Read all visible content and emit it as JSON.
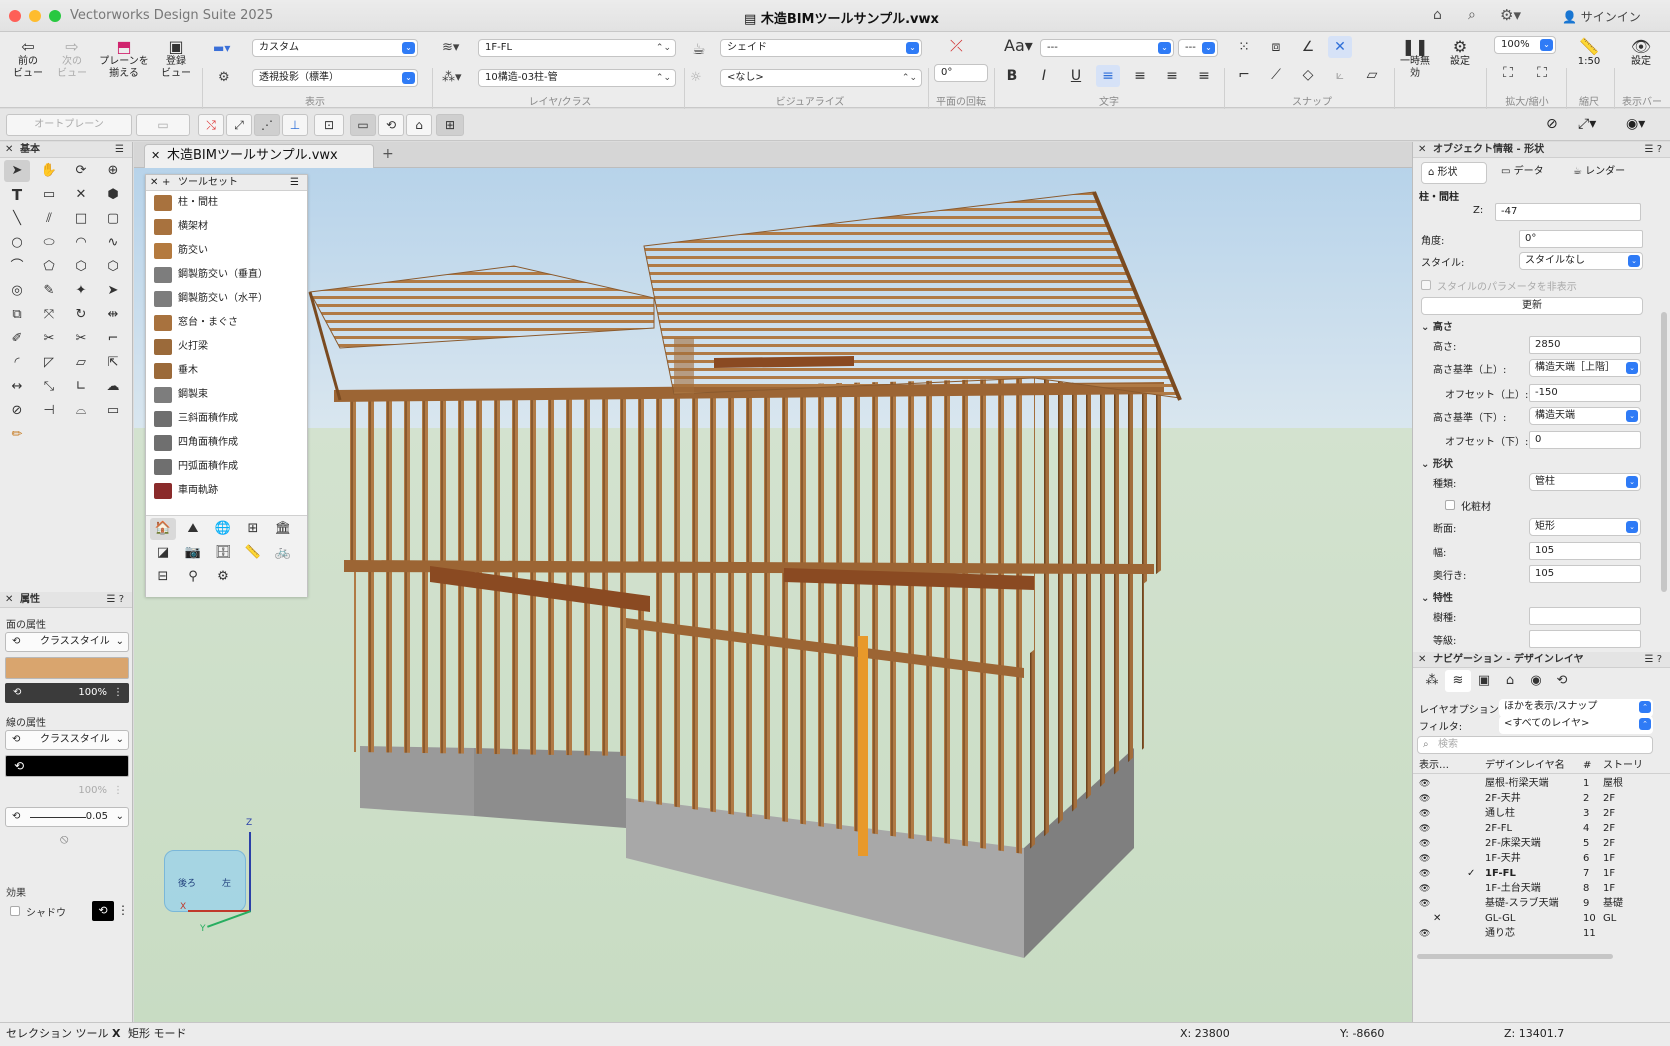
{
  "app_title": "Vectorworks Design Suite 2025",
  "doc_title": "木造BIMツールサンプル.vwx",
  "signin": "サインイン",
  "ribbon": {
    "prev_view": "前の\nビュー",
    "next_view": "次の\nビュー",
    "align_plane": "プレーンを\n揃える",
    "register_view": "登録\nビュー",
    "view_group": "表示",
    "layer_group": "レイヤ/クラス",
    "visualize_group": "ビジュアライズ",
    "plane_rot_group": "平面の回転",
    "text_group": "文字",
    "snap_group": "スナップ",
    "zoom_group": "拡大/縮小",
    "scale_group": "縮尺",
    "display_bar_group": "表示バー",
    "view_select": "カスタム",
    "projection": "透視投影（標準）",
    "layer": "1F-FL",
    "class": "10構造-03柱-管",
    "render_mode": "シェイド",
    "light": "<なし>",
    "rotation": "0°",
    "font": "---",
    "font_size": "---",
    "pause": "一時無効",
    "settings": "設定",
    "zoom": "100%",
    "scale": "1:50",
    "display_settings": "設定"
  },
  "toolbar2": {
    "auto_plane": "オートプレーン"
  },
  "left_panel": {
    "basic_title": "基本",
    "attr_title": "属性",
    "fill_attr": "面の属性",
    "fill_style": "クラススタイル",
    "fill_opacity": "100%",
    "line_attr": "線の属性",
    "line_style": "クラススタイル",
    "line_opacity": "100%",
    "line_weight": "0.05",
    "effects": "効果",
    "shadow": "シャドウ",
    "fill_color": "#d9a56e",
    "line_color": "#000000"
  },
  "tab": {
    "name": "木造BIMツールサンプル.vwx"
  },
  "toolset": {
    "title": "ツールセット",
    "items": [
      "柱・間柱",
      "横架材",
      "筋交い",
      "鋼製筋交い（垂直）",
      "鋼製筋交い（水平）",
      "窓台・まぐさ",
      "火打梁",
      "垂木",
      "鋼製束",
      "三斜面積作成",
      "四角面積作成",
      "円弧面積作成",
      "車両軌跡"
    ]
  },
  "viewcube": {
    "face1": "後ろ",
    "face2": "左",
    "axis_z": "Z",
    "axis_x": "X",
    "axis_y": "Y"
  },
  "obj_info": {
    "title": "オブジェクト情報 - 形状",
    "tab_shape": "形状",
    "tab_data": "データ",
    "tab_render": "レンダー",
    "object_type": "柱・間柱",
    "z_label": "Z:",
    "z_value": "-47",
    "angle_label": "角度:",
    "angle_value": "0°",
    "style_label": "スタイル:",
    "style_value": "スタイルなし",
    "hide_style_param": "スタイルのパラメータを非表示",
    "update": "更新",
    "height_section": "高さ",
    "height_label": "高さ:",
    "height_value": "2850",
    "height_top_label": "高さ基準（上）:",
    "height_top_value": "構造天端［上階］",
    "offset_top_label": "オフセット（上）:",
    "offset_top_value": "-150",
    "height_bottom_label": "高さ基準（下）:",
    "height_bottom_value": "構造天端",
    "offset_bottom_label": "オフセット（下）:",
    "offset_bottom_value": "0",
    "shape_section": "形状",
    "kind_label": "種類:",
    "kind_value": "管柱",
    "finish_label": "化粧材",
    "section_label": "断面:",
    "section_value": "矩形",
    "width_label": "幅:",
    "width_value": "105",
    "depth_label": "奥行き:",
    "depth_value": "105",
    "attr_section": "特性",
    "species_label": "樹種:",
    "species_value": "",
    "grade_label": "等級:",
    "grade_value": ""
  },
  "navigation": {
    "title": "ナビゲーション - デザインレイヤ",
    "layer_option_label": "レイヤオプション:",
    "layer_option_value": "ほかを表示/スナップ",
    "filter_label": "フィルタ:",
    "filter_value": "<すべてのレイヤ>",
    "search_placeholder": "検索",
    "col_visibility": "表示…",
    "col_name": "デザインレイヤ名",
    "col_num": "#",
    "col_story": "ストーリ",
    "layers": [
      {
        "name": "屋根-桁梁天端",
        "num": "1",
        "story": "屋根",
        "vis": "eye"
      },
      {
        "name": "2F-天井",
        "num": "2",
        "story": "2F",
        "vis": "eye"
      },
      {
        "name": "通し柱",
        "num": "3",
        "story": "2F",
        "vis": "eye"
      },
      {
        "name": "2F-FL",
        "num": "4",
        "story": "2F",
        "vis": "eye"
      },
      {
        "name": "2F-床梁天端",
        "num": "5",
        "story": "2F",
        "vis": "eye"
      },
      {
        "name": "1F-天井",
        "num": "6",
        "story": "1F",
        "vis": "eye"
      },
      {
        "name": "1F-FL",
        "num": "7",
        "story": "1F",
        "vis": "eye",
        "active": true
      },
      {
        "name": "1F-土台天端",
        "num": "8",
        "story": "1F",
        "vis": "eye"
      },
      {
        "name": "基礎-スラブ天端",
        "num": "9",
        "story": "基礎",
        "vis": "eye"
      },
      {
        "name": "GL-GL",
        "num": "10",
        "story": "GL",
        "vis": "hidden"
      },
      {
        "name": "通り芯",
        "num": "11",
        "story": "",
        "vis": "eye"
      }
    ]
  },
  "status": {
    "tool": "セレクション ツール",
    "mode_key": "X",
    "mode": "矩形 モード",
    "x": "X: 23800",
    "y": "Y: -8660",
    "z": "Z: 13401.7"
  }
}
